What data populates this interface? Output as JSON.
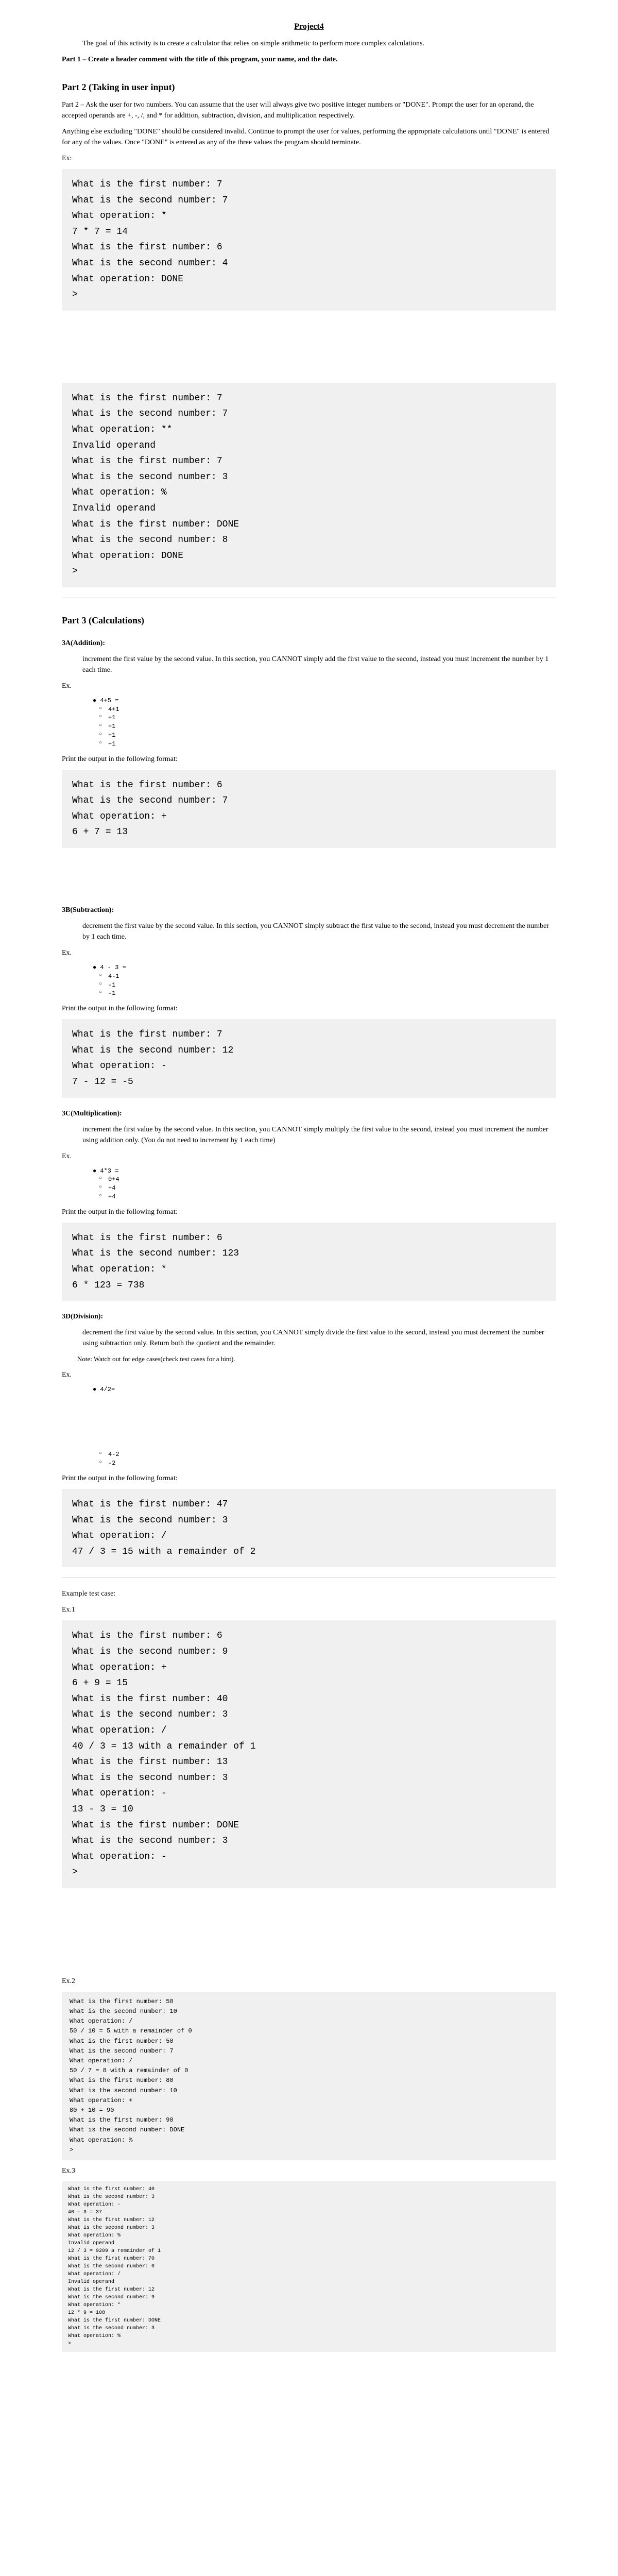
{
  "title": "Project4",
  "intro": "The goal of this activity is to create a calculator that relies on simple arithmetic to perform more complex calculations.",
  "part1_heading": "Part 1 – Create a header comment with the title of this program, your name, and the date.",
  "part2": {
    "heading": "Part 2 (Taking in user input)",
    "p1": "Part 2 – Ask the user for two numbers. You can assume that the user will always give two positive integer numbers or \"DONE\". Prompt the user for an operand, the accepted operands are +, -, /, and * for addition, subtraction, division, and multiplication respectively.",
    "p2": "Anything else excluding \"DONE\" should be considered invalid. Continue to prompt the user for values, performing the appropriate calculations until \"DONE\" is entered for any of the values. Once \"DONE\" is entered as any of the three values the program should terminate.",
    "ex_label": "Ex:",
    "terminal1": "What is the first number: 7\nWhat is the second number: 7\nWhat operation: *\n7 * 7 = 14\nWhat is the first number: 6\nWhat is the second number: 4\nWhat operation: DONE\n> ",
    "terminal2": "What is the first number: 7\nWhat is the second number: 7\nWhat operation: **\nInvalid operand\nWhat is the first number: 7\nWhat is the second number: 3\nWhat operation: %\nInvalid operand\nWhat is the first number: DONE\nWhat is the second number: 8\nWhat operation: DONE\n> "
  },
  "part3": {
    "heading": "Part 3 (Calculations)",
    "addition": {
      "heading": "3A(Addition):",
      "body": "increment the first value by the second value. In this section, you CANNOT simply add the first value to the second, instead you must increment the number by 1 each time.",
      "ex_label": "Ex.",
      "bullet": "● 4+5 =",
      "steps": [
        "4+1",
        "+1",
        "+1",
        "+1",
        "+1"
      ],
      "format_label": "Print the output in the following format:",
      "terminal": "What is the first number: 6\nWhat is the second number: 7\nWhat operation: +\n6 + 7 = 13"
    },
    "subtraction": {
      "heading": "3B(Subtraction):",
      "body": "decrement the first value by the second value. In this section, you CANNOT simply subtract the first value to the second, instead you must decrement the number by 1 each time.",
      "ex_label": "Ex.",
      "bullet": "● 4 - 3 =",
      "steps": [
        "4-1",
        "-1",
        "-1"
      ],
      "format_label": "Print the output in the following format:",
      "terminal": "What is the first number: 7\nWhat is the second number: 12\nWhat operation: -\n7 - 12 = -5"
    },
    "multiplication": {
      "heading": "3C(Multiplication):",
      "body": "increment the first value by the second value. In this section, you CANNOT simply multiply the first value to the second, instead you must increment the number using addition only. (You do not need to increment by 1 each time)",
      "ex_label": "Ex.",
      "bullet": "● 4*3 =",
      "steps": [
        "0+4",
        "+4",
        "+4"
      ],
      "format_label": "Print the output in the following format:",
      "terminal": "What is the first number: 6\nWhat is the second number: 123\nWhat operation: *\n6 * 123 = 738"
    },
    "division": {
      "heading": "3D(Division):",
      "body": "decrement the first value by the second value. In this section, you CANNOT simply divide the first value to the second, instead you must decrement the number using subtraction only. Return both the quotient and the remainder.",
      "note": "Note: Watch out for edge cases(check test cases for a hint).",
      "ex_label": "Ex.",
      "bullet": "● 4/2=",
      "steps": [
        "4-2",
        "-2"
      ],
      "format_label": "Print the output in the following format:",
      "terminal": "What is the first number: 47\nWhat is the second number: 3\nWhat operation: /\n47 / 3 = 15 with a remainder of 2"
    }
  },
  "example_heading": "Example test case:",
  "ex1_label": "Ex.1",
  "ex1_terminal": "What is the first number: 6\nWhat is the second number: 9\nWhat operation: +\n6 + 9 = 15\nWhat is the first number: 40\nWhat is the second number: 3\nWhat operation: /\n40 / 3 = 13 with a remainder of 1\nWhat is the first number: 13\nWhat is the second number: 3\nWhat operation: -\n13 - 3 = 10\nWhat is the first number: DONE\nWhat is the second number: 3\nWhat operation: -\n> ",
  "ex2_label": "Ex.2",
  "ex2_terminal": "What is the first number: 50\nWhat is the second number: 10\nWhat operation: /\n50 / 10 = 5 with a remainder of 0\nWhat is the first number: 50\nWhat is the second number: 7\nWhat operation: /\n50 / 7 = 8 with a remainder of 0\nWhat is the first number: 80\nWhat is the second number: 10\nWhat operation: +\n80 + 10 = 90\nWhat is the first number: 90\nWhat is the second number: DONE\nWhat operation: %\n> ",
  "ex3_label": "Ex.3",
  "ex3_terminal": "What is the first number: 40\nWhat is the second number: 3\nWhat operation: -\n40 - 3 = 37\nWhat is the first number: 12\nWhat is the second number: 3\nWhat operation: %\nInvalid operand\n12 / 3 = 9209 a remainder of 1\nWhat is the first number: 70\nWhat is the second number: 0\nWhat operation: /\nInvalid operand\nWhat is the first number: 12\nWhat is the second number: 9\nWhat operation: *\n12 * 9 = 108\nWhat is the first number: DONE\nWhat is the second number: 3\nWhat operation: %\n> "
}
